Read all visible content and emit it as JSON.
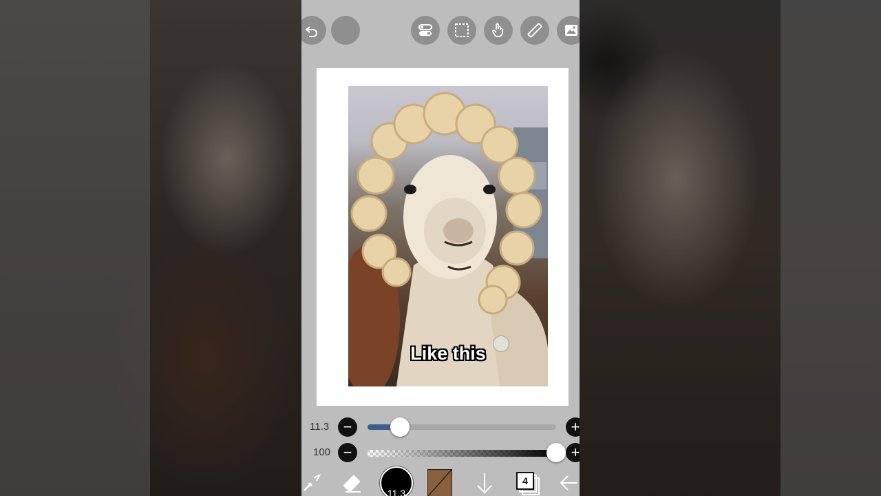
{
  "toolbar": {
    "undo_icon": "undo-icon",
    "redo_icon": "redo-icon",
    "items": [
      "toggle-icon",
      "selection-icon",
      "hand-icon",
      "ruler-icon",
      "image-icon"
    ]
  },
  "canvas": {
    "caption": "Like this"
  },
  "brush_size": {
    "value": "11.3",
    "level": 0.17
  },
  "opacity": {
    "value": "100",
    "level": 1.0
  },
  "bottom_bar": {
    "brush_size_label": "11.3",
    "layer_count": "4",
    "color": "#8a5f3c"
  },
  "colors": {
    "panel": "#bdbdbd",
    "slider_fill": "#3c5e8e"
  }
}
